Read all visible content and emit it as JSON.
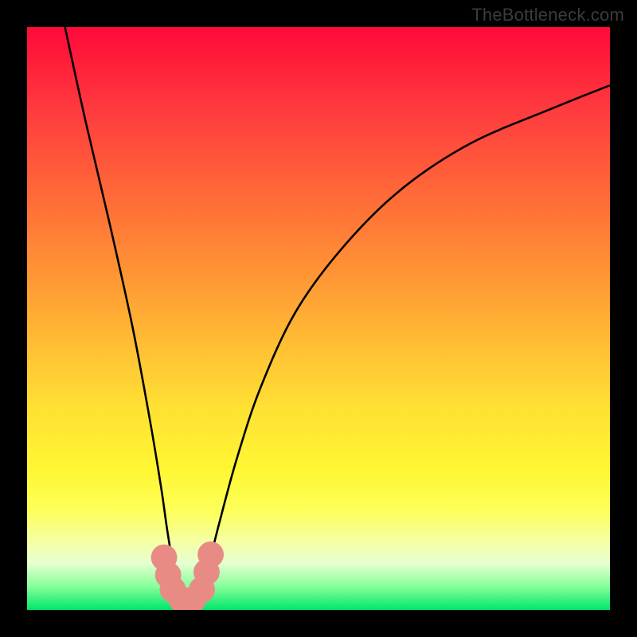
{
  "watermark": "TheBottleneck.com",
  "chart_data": {
    "type": "line",
    "title": "",
    "xlabel": "",
    "ylabel": "",
    "xlim": [
      0,
      100
    ],
    "ylim": [
      0,
      100
    ],
    "optimum_x": 27,
    "series": [
      {
        "name": "bottleneck-curve",
        "x": [
          6.5,
          10,
          14,
          18,
          21,
          23,
          24,
          25,
          26,
          27,
          28,
          29,
          30,
          31,
          33,
          36,
          40,
          46,
          54,
          64,
          76,
          90,
          100
        ],
        "values": [
          100,
          84,
          67,
          49,
          33,
          21,
          14,
          8,
          4,
          1,
          1,
          1,
          3,
          7,
          15,
          26,
          38,
          51,
          62,
          72,
          80,
          86,
          90
        ]
      }
    ],
    "markers": [
      {
        "x": 23.5,
        "y": 9.0,
        "r": 1.5
      },
      {
        "x": 24.2,
        "y": 6.0,
        "r": 1.5
      },
      {
        "x": 25.0,
        "y": 3.5,
        "r": 1.5
      },
      {
        "x": 26.5,
        "y": 1.8,
        "r": 1.5
      },
      {
        "x": 28.5,
        "y": 1.8,
        "r": 1.5
      },
      {
        "x": 30.0,
        "y": 3.5,
        "r": 1.5
      },
      {
        "x": 30.8,
        "y": 6.5,
        "r": 1.5
      },
      {
        "x": 31.5,
        "y": 9.5,
        "r": 1.5
      }
    ],
    "colors": {
      "curve": "#000000",
      "marker": "#e98b85",
      "gradient_top": "#ff0a3a",
      "gradient_bottom": "#00e66a"
    }
  }
}
